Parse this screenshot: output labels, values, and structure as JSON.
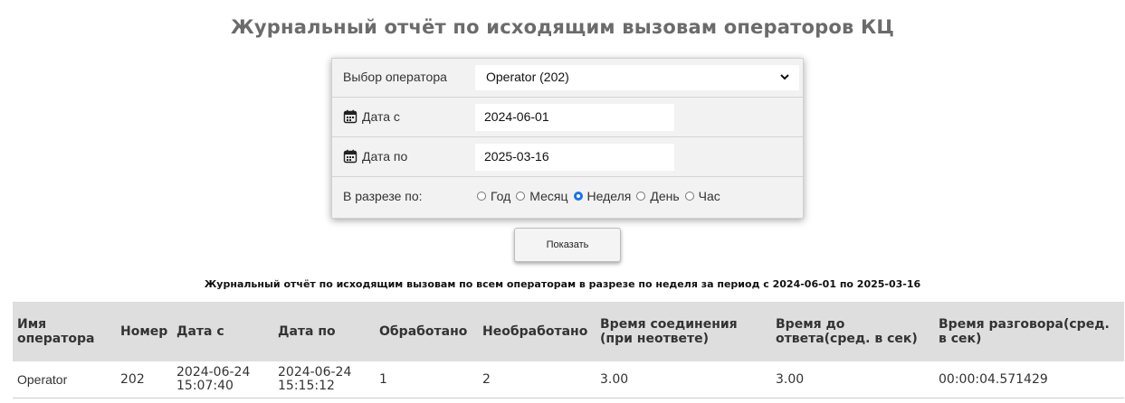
{
  "page": {
    "title": "Журнальный отчёт по исходящим вызовам операторов КЦ"
  },
  "form": {
    "operator_label": "Выбор оператора",
    "operator_value": "Operator (202)",
    "date_from_label": "Дата с",
    "date_from_value": "2024-06-01",
    "date_to_label": "Дата по",
    "date_to_value": "2025-03-16",
    "period_label": "В разрезе по:",
    "period_options": [
      {
        "label": "Год",
        "checked": false
      },
      {
        "label": "Месяц",
        "checked": false
      },
      {
        "label": "Неделя",
        "checked": true
      },
      {
        "label": "День",
        "checked": false
      },
      {
        "label": "Час",
        "checked": false
      }
    ],
    "submit_label": "Показать"
  },
  "report": {
    "caption": "Журнальный отчёт по исходящим вызовам по всем операторам в разрезе по неделя за период с 2024-06-01 по 2025-03-16",
    "columns": [
      "Имя оператора",
      "Номер",
      "Дата с",
      "Дата по",
      "Обработано",
      "Необработано",
      "Время соединения (при неответе)",
      "Время до ответа(сред. в сек)",
      "Время разговора(сред. в сек)"
    ],
    "rows": [
      [
        "Operator",
        "202",
        "2024-06-24 15:07:40",
        "2024-06-24 15:15:12",
        "1",
        "2",
        "3.00",
        "3.00",
        "00:00:04.571429"
      ]
    ]
  },
  "colors": {
    "accent": "#1a73e8",
    "header_bg": "#dedede",
    "form_bg": "#f2f2f2",
    "title_text": "#6b6b6b"
  },
  "icons": {
    "calendar": "calendar-icon",
    "dropdown": "chevron-down-icon"
  }
}
